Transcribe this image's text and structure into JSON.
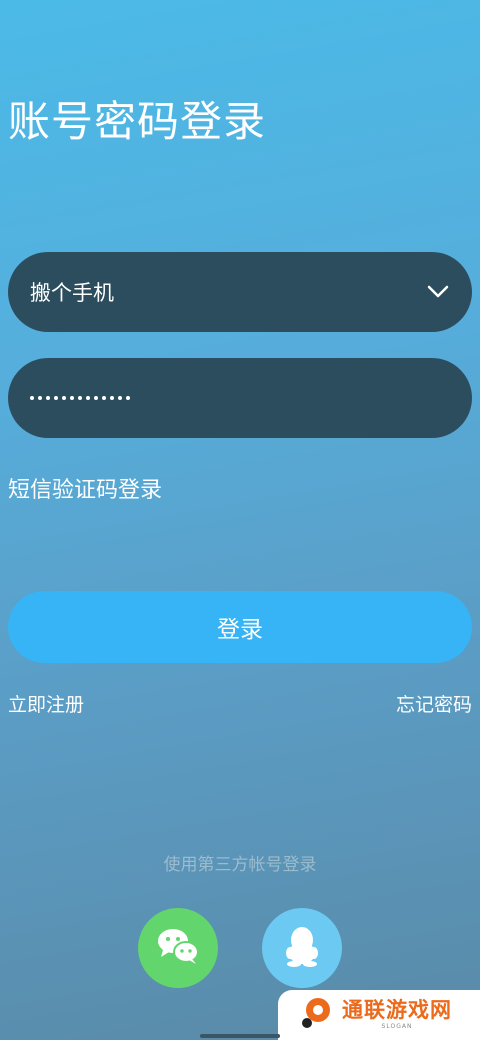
{
  "page": {
    "title": "账号密码登录"
  },
  "account_field": {
    "value": "搬个手机",
    "icon": "chevron-down-icon"
  },
  "password_field": {
    "masked_length": 13
  },
  "links": {
    "sms_login": "短信验证码登录",
    "register": "立即注册",
    "forgot_password": "忘记密码"
  },
  "login_button": {
    "label": "登录",
    "color": "#36b4f5"
  },
  "third_party": {
    "title": "使用第三方帐号登录",
    "providers": [
      {
        "name": "wechat",
        "icon": "wechat-icon",
        "color": "#63d56d"
      },
      {
        "name": "qq",
        "icon": "qq-penguin-icon",
        "color": "#6ccaf2"
      }
    ]
  },
  "watermark": {
    "name": "通联游戏网",
    "slogan": "SLOGAN"
  },
  "colors": {
    "field_background": "#2c4d5e",
    "brand_orange": "#ec6a1c"
  }
}
